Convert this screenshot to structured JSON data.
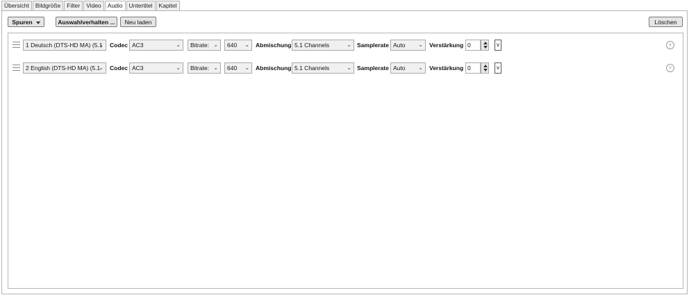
{
  "tabs": [
    {
      "label": "Übersicht",
      "active": false
    },
    {
      "label": "Bildgröße",
      "active": false
    },
    {
      "label": "Filter",
      "active": false
    },
    {
      "label": "Video",
      "active": false
    },
    {
      "label": "Audio",
      "active": true
    },
    {
      "label": "Untertitel",
      "active": false
    },
    {
      "label": "Kapitel",
      "active": false
    }
  ],
  "toolbar": {
    "tracks_label": "Spuren",
    "selection_behavior_label": "Auswahlverhalten ...",
    "reload_label": "Neu laden",
    "delete_label": "Löschen"
  },
  "labels": {
    "codec": "Codec",
    "mixdown": "Abmischung",
    "samplerate": "Samplerate",
    "gain": "Verstärkung",
    "v_button": "v",
    "chevron": "⌄",
    "remove_glyph": "×"
  },
  "tracks": [
    {
      "source": "1 Deutsch (DTS-HD MA) (5.1",
      "codec": "AC3",
      "bitrate_mode": "Bitrate:",
      "bitrate": "640",
      "mixdown": "5.1 Channels",
      "samplerate": "Auto",
      "gain": "0"
    },
    {
      "source": "2 English (DTS-HD MA) (5.1",
      "codec": "AC3",
      "bitrate_mode": "Bitrate:",
      "bitrate": "640",
      "mixdown": "5.1 Channels",
      "samplerate": "Auto",
      "gain": "0"
    }
  ]
}
